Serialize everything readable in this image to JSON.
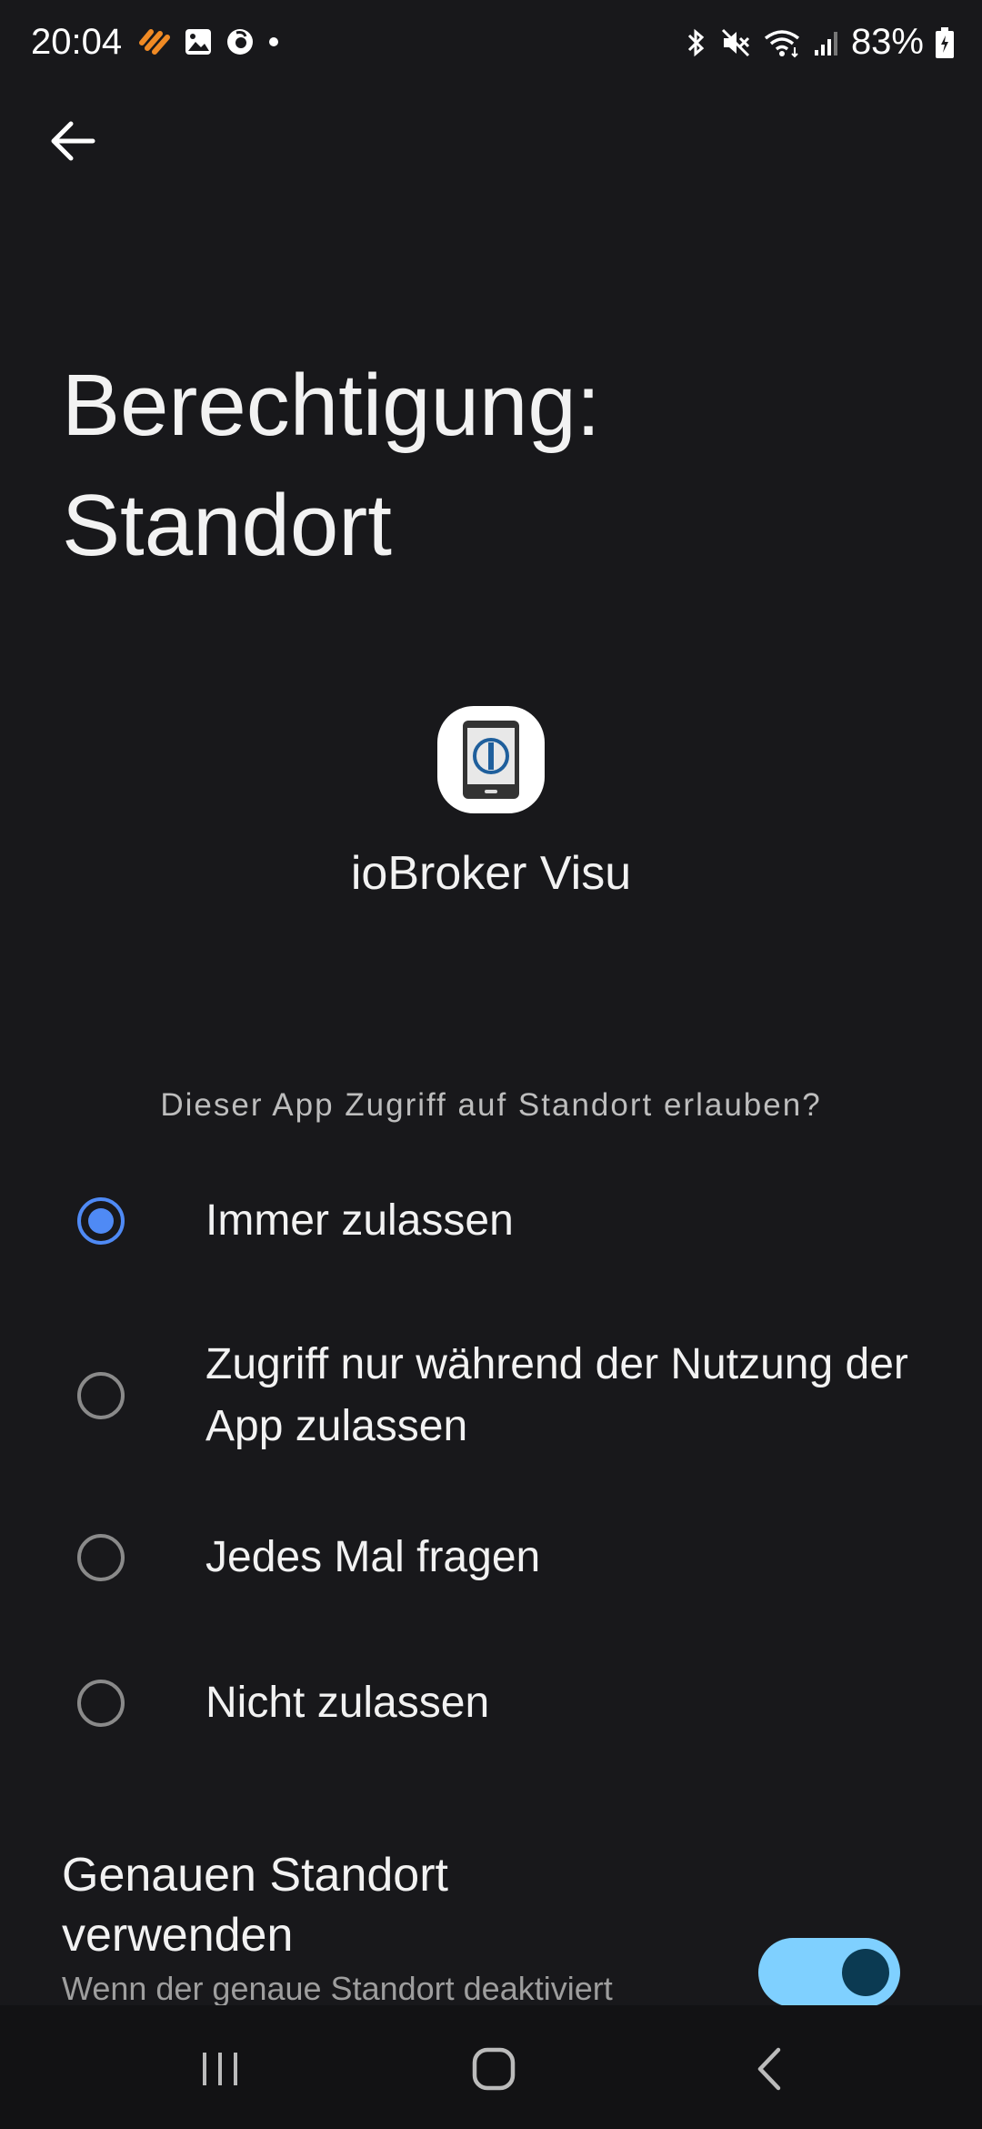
{
  "status_bar": {
    "time": "20:04",
    "battery": "83%",
    "left_icons": [
      "app-notification-icon",
      "gallery-icon",
      "vodafone-icon",
      "dot-icon"
    ],
    "right_icons": [
      "bluetooth-icon",
      "mute-icon",
      "wifi-icon",
      "signal-icon",
      "battery-icon"
    ]
  },
  "header": {
    "title": "Berechtigung: Standort"
  },
  "app": {
    "name": "ioBroker Visu"
  },
  "permission": {
    "question": "Dieser App Zugriff auf Standort erlauben?",
    "options": [
      {
        "label": "Immer zulassen",
        "selected": true
      },
      {
        "label": "Zugriff nur während der Nutzung der App zulassen",
        "selected": false
      },
      {
        "label": "Jedes Mal fragen",
        "selected": false
      },
      {
        "label": "Nicht zulassen",
        "selected": false
      }
    ]
  },
  "precise_location": {
    "title": "Genauen Standort verwenden",
    "description": "Wenn der genaue Standort deaktiviert",
    "enabled": true
  },
  "colors": {
    "background": "#18181b",
    "accent": "#4f8af5",
    "toggle_track": "#7fd0ff",
    "toggle_knob": "#0b3a52"
  }
}
